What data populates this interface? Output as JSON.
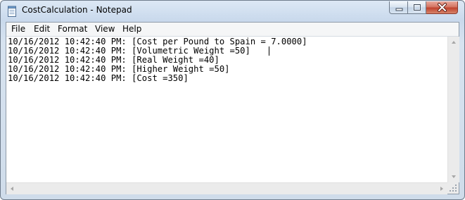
{
  "window": {
    "title": "CostCalculation - Notepad"
  },
  "menu": {
    "items": [
      {
        "label": "File"
      },
      {
        "label": "Edit"
      },
      {
        "label": "Format"
      },
      {
        "label": "View"
      },
      {
        "label": "Help"
      }
    ]
  },
  "editor": {
    "lines": [
      "10/16/2012 10:42:40 PM: [Cost per Pound to Spain = 7.0000]",
      "10/16/2012 10:42:40 PM: [Volumetric Weight =50]",
      "10/16/2012 10:42:40 PM: [Real Weight =40]",
      "10/16/2012 10:42:40 PM: [Higher Weight =50]",
      "10/16/2012 10:42:40 PM: [Cost =350]"
    ]
  },
  "icons": {
    "app": "notepad-icon",
    "minimize": "minimize-icon",
    "maximize": "maximize-icon",
    "close": "close-icon"
  },
  "colors": {
    "frame": "#c9d9ec",
    "close_button": "#c0432e",
    "text": "#000000"
  }
}
